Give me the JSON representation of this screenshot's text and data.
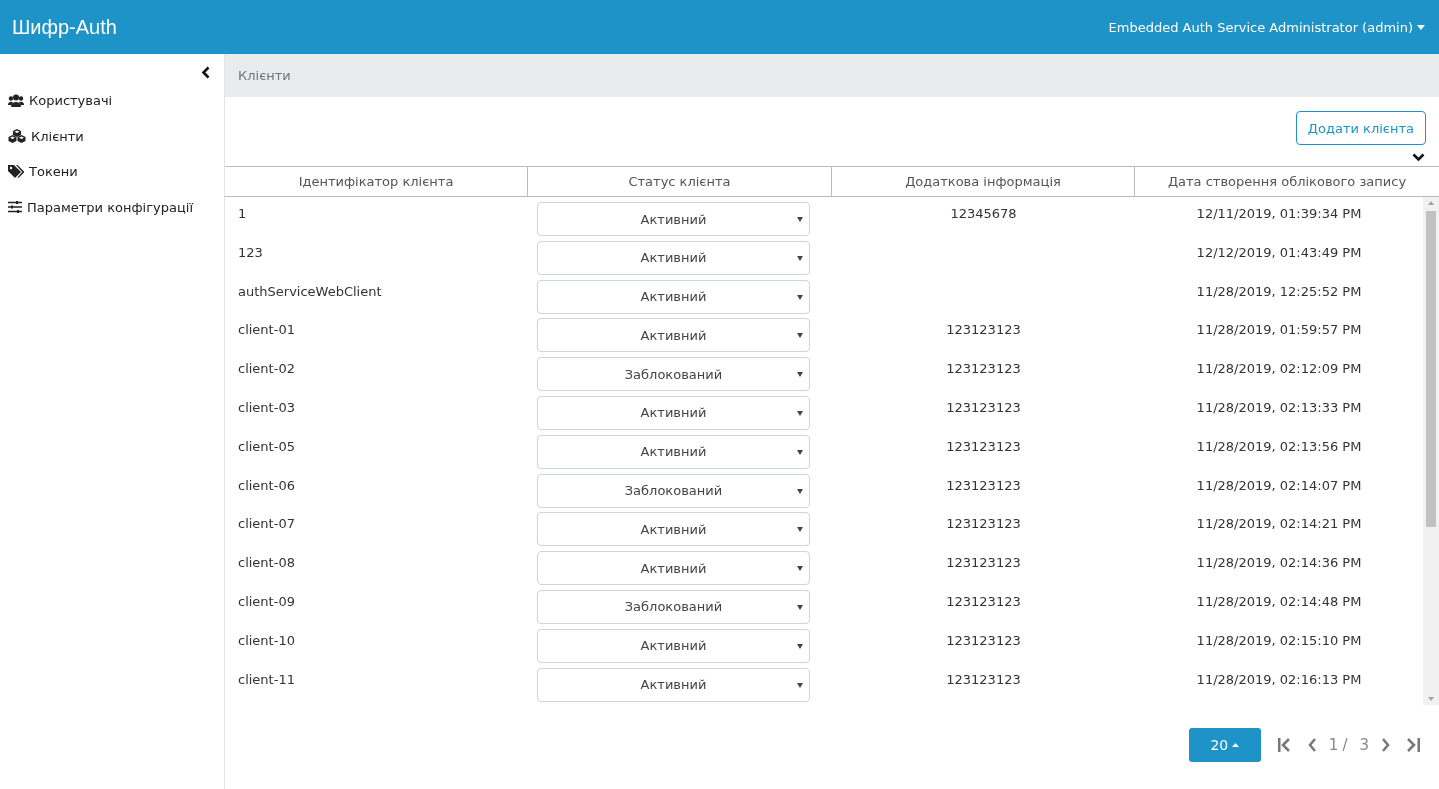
{
  "header": {
    "brand": "Шифр-Auth",
    "user": "Embedded Auth Service Administrator (admin)"
  },
  "sidebar": {
    "items": [
      {
        "label": "Користувачі",
        "selected": false
      },
      {
        "label": "Клієнти",
        "selected": false
      },
      {
        "label": "Токени",
        "selected": false
      },
      {
        "label": "Параметри конфігурації",
        "selected": false
      }
    ]
  },
  "breadcrumb": "Клієнти",
  "add_button": "Додати клієнта",
  "table": {
    "columns": [
      "Ідентифікатор клієнта",
      "Статус клієнта",
      "Додаткова інформація",
      "Дата створення облікового запису"
    ],
    "rows": [
      {
        "id": "1",
        "status": "Активний",
        "info": "12345678",
        "created": "12/11/2019, 01:39:34 PM"
      },
      {
        "id": "123",
        "status": "Активний",
        "info": "",
        "created": "12/12/2019, 01:43:49 PM"
      },
      {
        "id": "authServiceWebClient",
        "status": "Активний",
        "info": "",
        "created": "11/28/2019, 12:25:52 PM"
      },
      {
        "id": "client-01",
        "status": "Активний",
        "info": "123123123",
        "created": "11/28/2019, 01:59:57 PM"
      },
      {
        "id": "client-02",
        "status": "Заблокований",
        "info": "123123123",
        "created": "11/28/2019, 02:12:09 PM"
      },
      {
        "id": "client-03",
        "status": "Активний",
        "info": "123123123",
        "created": "11/28/2019, 02:13:33 PM"
      },
      {
        "id": "client-05",
        "status": "Активний",
        "info": "123123123",
        "created": "11/28/2019, 02:13:56 PM"
      },
      {
        "id": "client-06",
        "status": "Заблокований",
        "info": "123123123",
        "created": "11/28/2019, 02:14:07 PM"
      },
      {
        "id": "client-07",
        "status": "Активний",
        "info": "123123123",
        "created": "11/28/2019, 02:14:21 PM"
      },
      {
        "id": "client-08",
        "status": "Активний",
        "info": "123123123",
        "created": "11/28/2019, 02:14:36 PM"
      },
      {
        "id": "client-09",
        "status": "Заблокований",
        "info": "123123123",
        "created": "11/28/2019, 02:14:48 PM"
      },
      {
        "id": "client-10",
        "status": "Активний",
        "info": "123123123",
        "created": "11/28/2019, 02:15:10 PM"
      },
      {
        "id": "client-11",
        "status": "Активний",
        "info": "123123123",
        "created": "11/28/2019, 02:16:13 PM"
      }
    ]
  },
  "pagination": {
    "page_size": "20",
    "current": "1",
    "separator": "/",
    "total": "3"
  }
}
